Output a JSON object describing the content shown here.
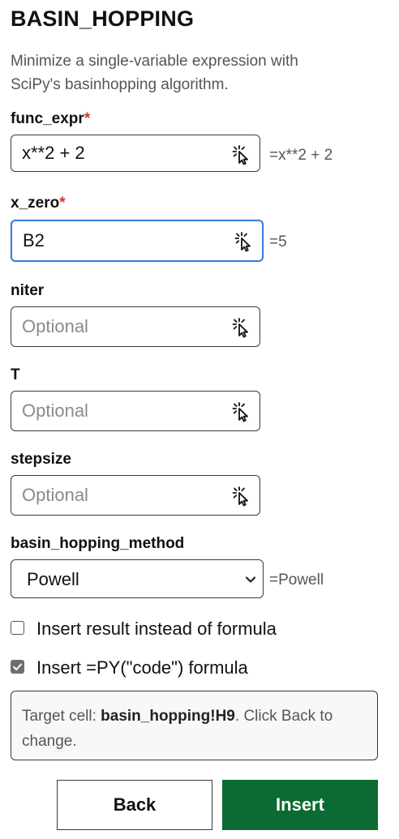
{
  "header": {
    "title": "BASIN_HOPPING",
    "description": "Minimize a single-variable expression with SciPy's basinhopping algorithm."
  },
  "fields": [
    {
      "label": "func_expr",
      "required_mark": "*",
      "value": "x**2 + 2",
      "placeholder": "",
      "preview": "=x**2 + 2"
    },
    {
      "label": "x_zero",
      "required_mark": "*",
      "value": "B2",
      "placeholder": "",
      "preview": "=5"
    },
    {
      "label": "niter",
      "value": "",
      "placeholder": "Optional"
    },
    {
      "label": "T",
      "value": "",
      "placeholder": "Optional"
    },
    {
      "label": "stepsize",
      "value": "",
      "placeholder": "Optional"
    }
  ],
  "method": {
    "label": "basin_hopping_method",
    "selected": "Powell",
    "preview": "=Powell"
  },
  "options": {
    "insert_result": {
      "label": "Insert result instead of formula",
      "checked": false
    },
    "insert_py": {
      "label": "Insert =PY(\"code\") formula",
      "checked": true
    }
  },
  "target": {
    "prefix": "Target cell: ",
    "cell": "basin_hopping!H9",
    "suffix": ". Click Back to change."
  },
  "buttons": {
    "back": "Back",
    "insert": "Insert"
  },
  "colors": {
    "accent": "#0c6b33",
    "focus": "#3b7ddd",
    "required": "#d0343a"
  },
  "icons": {
    "cell_picker": "cursor-click-icon",
    "dropdown": "chevron-down-icon",
    "checkmark": "check-icon"
  }
}
